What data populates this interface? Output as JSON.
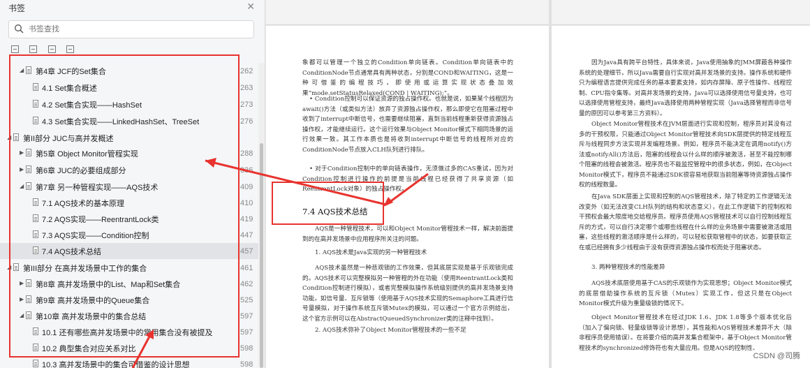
{
  "sidebar": {
    "title": "书签",
    "search_placeholder": "书签查找",
    "items": [
      {
        "label": "第4章 JCF的Set集合",
        "page": "262"
      },
      {
        "label": "4.1 Set集合概述",
        "page": "263"
      },
      {
        "label": "4.2 Set集合实现——HashSet",
        "page": "273"
      },
      {
        "label": "4.3 Set集合实现——LinkedHashSet、TreeSet",
        "page": "276"
      },
      {
        "label": "第II部分 JUC与高并发概述",
        "page": ""
      },
      {
        "label": "第5章 Object Monitor管程实现",
        "page": "288"
      },
      {
        "label": "第6章 JUC的必要组成部分",
        "page": "336"
      },
      {
        "label": "第7章 另一种管程实现——AQS技术",
        "page": "409"
      },
      {
        "label": "7.1 AQS技术的基本原理",
        "page": "410"
      },
      {
        "label": "7.2 AQS实现——ReentrantLock类",
        "page": "419"
      },
      {
        "label": "7.3 AQS实现——Condition控制",
        "page": "447"
      },
      {
        "label": "7.4 AQS技术总结",
        "page": "457"
      },
      {
        "label": "第III部分 在高并发场景中工作的集合",
        "page": "461"
      },
      {
        "label": "第8章 高并发场景中的List、Map和Set集合",
        "page": "462"
      },
      {
        "label": "第9章 高并发场景中的Queue集合",
        "page": "525"
      },
      {
        "label": "第10章 高并发场景中的集合总结",
        "page": "597"
      },
      {
        "label": "10.1 还有哪些高并发场景中的常用集合没有被提及",
        "page": "597"
      },
      {
        "label": "10.2 典型集合对应关系对比",
        "page": "598"
      },
      {
        "label": "10.3 高并发场景中的集合可借鉴的设计思想",
        "page": "598"
      }
    ]
  },
  "left_page": {
    "para1": "象都可以管理一个独立的Condition单向链表。Condition单向链表中的ConditionNode节点通常具有两种状态，分别是COND和WAITING，这是一种可借鉴的编程技巧，即使用或运算实现状态叠加效果“mode.setStatusRelaxed(COND | WAITING);”。",
    "para2": "• Condition控制可以保证资源的独占操作权。也就是说，如果某个线程因为await()方法（或类似方法）放弃了资源独占操作权，那么即使它在阻塞过程中收到了interrupt中断信号，也需要继续阻塞，直到当前线程重新获得资源独占操作权，才能继续运行。这个运行效果与Object Monitor模式下相同场景的运行效果一致。其工作本质也是将收到interrupt中断信号的线程所对应的ConditionNode节点放入CLH队列进行排队。",
    "para3": "• 对于Condition控制中的单向链表操作，无须做过多的CAS重试，因为对Condition控制进行操作的前提是当前线程已经获得了共享资源（如ReentrantLock对象）的独占操作权。",
    "heading": "7.4   AQS技术总结",
    "para4": "AQS是一种管程技术，可以和Object Monitor管程技术一样，解决前面提到的在高并发场景中应用程序所关注的问题。",
    "para5": "1. AQS技术是Java实现的另一种管程技术",
    "para6": "AQS技术虽然是一种悲观锁的工作效果，但其底层实现是基于乐观锁完成的。AQS技术可以完整模拟另一种管程的外在功能（使用ReentrantLock类和Condition控制进行模拟），或者完整模拟操作系统级别提供的高并发场景支持功能，如信号量、互斥锁等（使用基于AQS技术实现的Semaphore工具进行信号量模拟，对于操作系统互斥锁Mutex的模拟，可以通过一个官方示例给出，这个官方示例可以在AbstractQueuedSynchronizer类的注释中找到）。",
    "para7": "2. AQS技术弥补了Object Monitor管程技术的一些不足"
  },
  "right_page": {
    "para1": "因为Java具有跨平台特性，具体来说，Java使用抽象的JMM屏蔽各种操作系统的处理细节，所以Java需要自行实现对高并发场景的支持。操作系统和硬件只为编程语言提供完成任务的基本要素支持，如内存屏障、原子性操作、线程控制、CPU指令集等。对高并发场景的支持，Java可以选择使用信号量支持，也可以选择使用管程支持，最终Java选择使用两种管程实现（Java选择管程而非信号量的原因可以参考第三方资料）。",
    "para2": "Object Monitor管程技术在JVM层面进行实现和控制，程序员对其没有过多的干预权限，只能通过Object Monitor管程技术向SDK层提供的特定线程互斥与线程同步方法实现并发编程场景。例如，程序员不能决定在调用notify()方法或notifyAll()方法后，阻塞的线程会以什么样的顺序被激活，甚至不能控制哪个阻塞的线程会被激活。程序员也不能监控管程中的很多状态，例如，在Object Monitor模式下，程序员不能通过SDK很容易地获取当前阻塞等待资源独占操作权的线程数量。",
    "para3": "在Java SDK层面上实现和控制的AQS管程技术，除了特定的工作逻辑无法改变外（如无法改变CLH队列的结构和状态意义），在此工作逻辑下的控制权和干预权会最大限度地交给程序员。程序员使用AQS管程技术可以自行控制线程互斥的方式，可以自行决定哪个或哪些线程在什么样的业务场景中需要被激活或阻塞，这些线程的激活顺序是什么样的，可以轻松获取管程中的状态，如要获取正在或已经拥有多少线程由于没有获得资源独占操作权而处于阻塞状态。",
    "para4": "3. 两种管程技术的性能差异",
    "para5": "AQS技术底层使用基于CAS的乐观锁作为实现思想；Object Monitor模式的底层借助操作系统的互斥锁（Mutex）实现工作，但这只是在Object Monitor模式升级为重量级锁的情况下。",
    "para6": "Object Monitor管程技术在经过JDK 1.6、JDK 1.8等多个版本优化后（加入了偏向锁、轻量级锁等设计思想），其性能和AQS管程技术差异不大（除非程序员使用错误）。在将要介绍的高并发集合框架中，基于Object Monitor管程技术的synchronized修饰符也有大量应用。但是AQS的控制性、"
  },
  "watermark": "CSDN @司腾",
  "colors": {
    "annotation_red": "#e8332e"
  }
}
